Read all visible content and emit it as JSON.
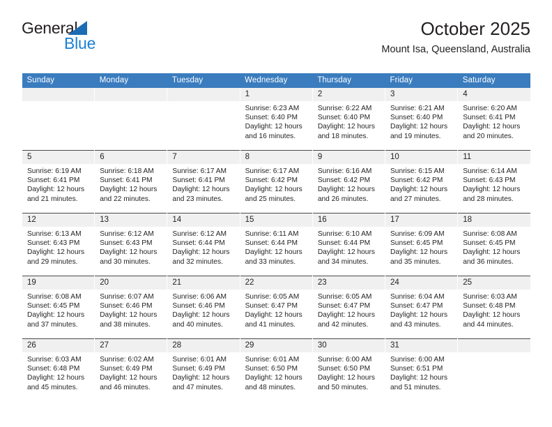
{
  "brand": {
    "name_top": "General",
    "name_bottom": "Blue",
    "accent_color": "#1b7fd4",
    "triangle_color": "#1d6cb3",
    "logo_icon": "blue-triangle-icon"
  },
  "header": {
    "title": "October 2025",
    "subtitle": "Mount Isa, Queensland, Australia"
  },
  "theme": {
    "header_row_bg": "#3a7cbe",
    "header_row_text": "#ffffff",
    "daynum_bg": "#f0f0f0",
    "cell_bg": "#ffffff",
    "text_color": "#231f20",
    "row_separator": "#4a4a4a"
  },
  "calendar": {
    "weekday_headers": [
      "Sunday",
      "Monday",
      "Tuesday",
      "Wednesday",
      "Thursday",
      "Friday",
      "Saturday"
    ],
    "labels": {
      "sunrise_prefix": "Sunrise:",
      "sunset_prefix": "Sunset:",
      "daylight_prefix": "Daylight:"
    },
    "weeks": [
      [
        {
          "day": "",
          "empty": true,
          "line1": "",
          "line2": "",
          "line3": "",
          "line4": ""
        },
        {
          "day": "",
          "empty": true,
          "line1": "",
          "line2": "",
          "line3": "",
          "line4": ""
        },
        {
          "day": "",
          "empty": true,
          "line1": "",
          "line2": "",
          "line3": "",
          "line4": ""
        },
        {
          "day": "1",
          "empty": false,
          "line1": "Sunrise: 6:23 AM",
          "line2": "Sunset: 6:40 PM",
          "line3": "Daylight: 12 hours",
          "line4": "and 16 minutes."
        },
        {
          "day": "2",
          "empty": false,
          "line1": "Sunrise: 6:22 AM",
          "line2": "Sunset: 6:40 PM",
          "line3": "Daylight: 12 hours",
          "line4": "and 18 minutes."
        },
        {
          "day": "3",
          "empty": false,
          "line1": "Sunrise: 6:21 AM",
          "line2": "Sunset: 6:40 PM",
          "line3": "Daylight: 12 hours",
          "line4": "and 19 minutes."
        },
        {
          "day": "4",
          "empty": false,
          "line1": "Sunrise: 6:20 AM",
          "line2": "Sunset: 6:41 PM",
          "line3": "Daylight: 12 hours",
          "line4": "and 20 minutes."
        }
      ],
      [
        {
          "day": "5",
          "empty": false,
          "line1": "Sunrise: 6:19 AM",
          "line2": "Sunset: 6:41 PM",
          "line3": "Daylight: 12 hours",
          "line4": "and 21 minutes."
        },
        {
          "day": "6",
          "empty": false,
          "line1": "Sunrise: 6:18 AM",
          "line2": "Sunset: 6:41 PM",
          "line3": "Daylight: 12 hours",
          "line4": "and 22 minutes."
        },
        {
          "day": "7",
          "empty": false,
          "line1": "Sunrise: 6:17 AM",
          "line2": "Sunset: 6:41 PM",
          "line3": "Daylight: 12 hours",
          "line4": "and 23 minutes."
        },
        {
          "day": "8",
          "empty": false,
          "line1": "Sunrise: 6:17 AM",
          "line2": "Sunset: 6:42 PM",
          "line3": "Daylight: 12 hours",
          "line4": "and 25 minutes."
        },
        {
          "day": "9",
          "empty": false,
          "line1": "Sunrise: 6:16 AM",
          "line2": "Sunset: 6:42 PM",
          "line3": "Daylight: 12 hours",
          "line4": "and 26 minutes."
        },
        {
          "day": "10",
          "empty": false,
          "line1": "Sunrise: 6:15 AM",
          "line2": "Sunset: 6:42 PM",
          "line3": "Daylight: 12 hours",
          "line4": "and 27 minutes."
        },
        {
          "day": "11",
          "empty": false,
          "line1": "Sunrise: 6:14 AM",
          "line2": "Sunset: 6:43 PM",
          "line3": "Daylight: 12 hours",
          "line4": "and 28 minutes."
        }
      ],
      [
        {
          "day": "12",
          "empty": false,
          "line1": "Sunrise: 6:13 AM",
          "line2": "Sunset: 6:43 PM",
          "line3": "Daylight: 12 hours",
          "line4": "and 29 minutes."
        },
        {
          "day": "13",
          "empty": false,
          "line1": "Sunrise: 6:12 AM",
          "line2": "Sunset: 6:43 PM",
          "line3": "Daylight: 12 hours",
          "line4": "and 30 minutes."
        },
        {
          "day": "14",
          "empty": false,
          "line1": "Sunrise: 6:12 AM",
          "line2": "Sunset: 6:44 PM",
          "line3": "Daylight: 12 hours",
          "line4": "and 32 minutes."
        },
        {
          "day": "15",
          "empty": false,
          "line1": "Sunrise: 6:11 AM",
          "line2": "Sunset: 6:44 PM",
          "line3": "Daylight: 12 hours",
          "line4": "and 33 minutes."
        },
        {
          "day": "16",
          "empty": false,
          "line1": "Sunrise: 6:10 AM",
          "line2": "Sunset: 6:44 PM",
          "line3": "Daylight: 12 hours",
          "line4": "and 34 minutes."
        },
        {
          "day": "17",
          "empty": false,
          "line1": "Sunrise: 6:09 AM",
          "line2": "Sunset: 6:45 PM",
          "line3": "Daylight: 12 hours",
          "line4": "and 35 minutes."
        },
        {
          "day": "18",
          "empty": false,
          "line1": "Sunrise: 6:08 AM",
          "line2": "Sunset: 6:45 PM",
          "line3": "Daylight: 12 hours",
          "line4": "and 36 minutes."
        }
      ],
      [
        {
          "day": "19",
          "empty": false,
          "line1": "Sunrise: 6:08 AM",
          "line2": "Sunset: 6:45 PM",
          "line3": "Daylight: 12 hours",
          "line4": "and 37 minutes."
        },
        {
          "day": "20",
          "empty": false,
          "line1": "Sunrise: 6:07 AM",
          "line2": "Sunset: 6:46 PM",
          "line3": "Daylight: 12 hours",
          "line4": "and 38 minutes."
        },
        {
          "day": "21",
          "empty": false,
          "line1": "Sunrise: 6:06 AM",
          "line2": "Sunset: 6:46 PM",
          "line3": "Daylight: 12 hours",
          "line4": "and 40 minutes."
        },
        {
          "day": "22",
          "empty": false,
          "line1": "Sunrise: 6:05 AM",
          "line2": "Sunset: 6:47 PM",
          "line3": "Daylight: 12 hours",
          "line4": "and 41 minutes."
        },
        {
          "day": "23",
          "empty": false,
          "line1": "Sunrise: 6:05 AM",
          "line2": "Sunset: 6:47 PM",
          "line3": "Daylight: 12 hours",
          "line4": "and 42 minutes."
        },
        {
          "day": "24",
          "empty": false,
          "line1": "Sunrise: 6:04 AM",
          "line2": "Sunset: 6:47 PM",
          "line3": "Daylight: 12 hours",
          "line4": "and 43 minutes."
        },
        {
          "day": "25",
          "empty": false,
          "line1": "Sunrise: 6:03 AM",
          "line2": "Sunset: 6:48 PM",
          "line3": "Daylight: 12 hours",
          "line4": "and 44 minutes."
        }
      ],
      [
        {
          "day": "26",
          "empty": false,
          "line1": "Sunrise: 6:03 AM",
          "line2": "Sunset: 6:48 PM",
          "line3": "Daylight: 12 hours",
          "line4": "and 45 minutes."
        },
        {
          "day": "27",
          "empty": false,
          "line1": "Sunrise: 6:02 AM",
          "line2": "Sunset: 6:49 PM",
          "line3": "Daylight: 12 hours",
          "line4": "and 46 minutes."
        },
        {
          "day": "28",
          "empty": false,
          "line1": "Sunrise: 6:01 AM",
          "line2": "Sunset: 6:49 PM",
          "line3": "Daylight: 12 hours",
          "line4": "and 47 minutes."
        },
        {
          "day": "29",
          "empty": false,
          "line1": "Sunrise: 6:01 AM",
          "line2": "Sunset: 6:50 PM",
          "line3": "Daylight: 12 hours",
          "line4": "and 48 minutes."
        },
        {
          "day": "30",
          "empty": false,
          "line1": "Sunrise: 6:00 AM",
          "line2": "Sunset: 6:50 PM",
          "line3": "Daylight: 12 hours",
          "line4": "and 50 minutes."
        },
        {
          "day": "31",
          "empty": false,
          "line1": "Sunrise: 6:00 AM",
          "line2": "Sunset: 6:51 PM",
          "line3": "Daylight: 12 hours",
          "line4": "and 51 minutes."
        },
        {
          "day": "",
          "empty": true,
          "line1": "",
          "line2": "",
          "line3": "",
          "line4": ""
        }
      ]
    ]
  }
}
